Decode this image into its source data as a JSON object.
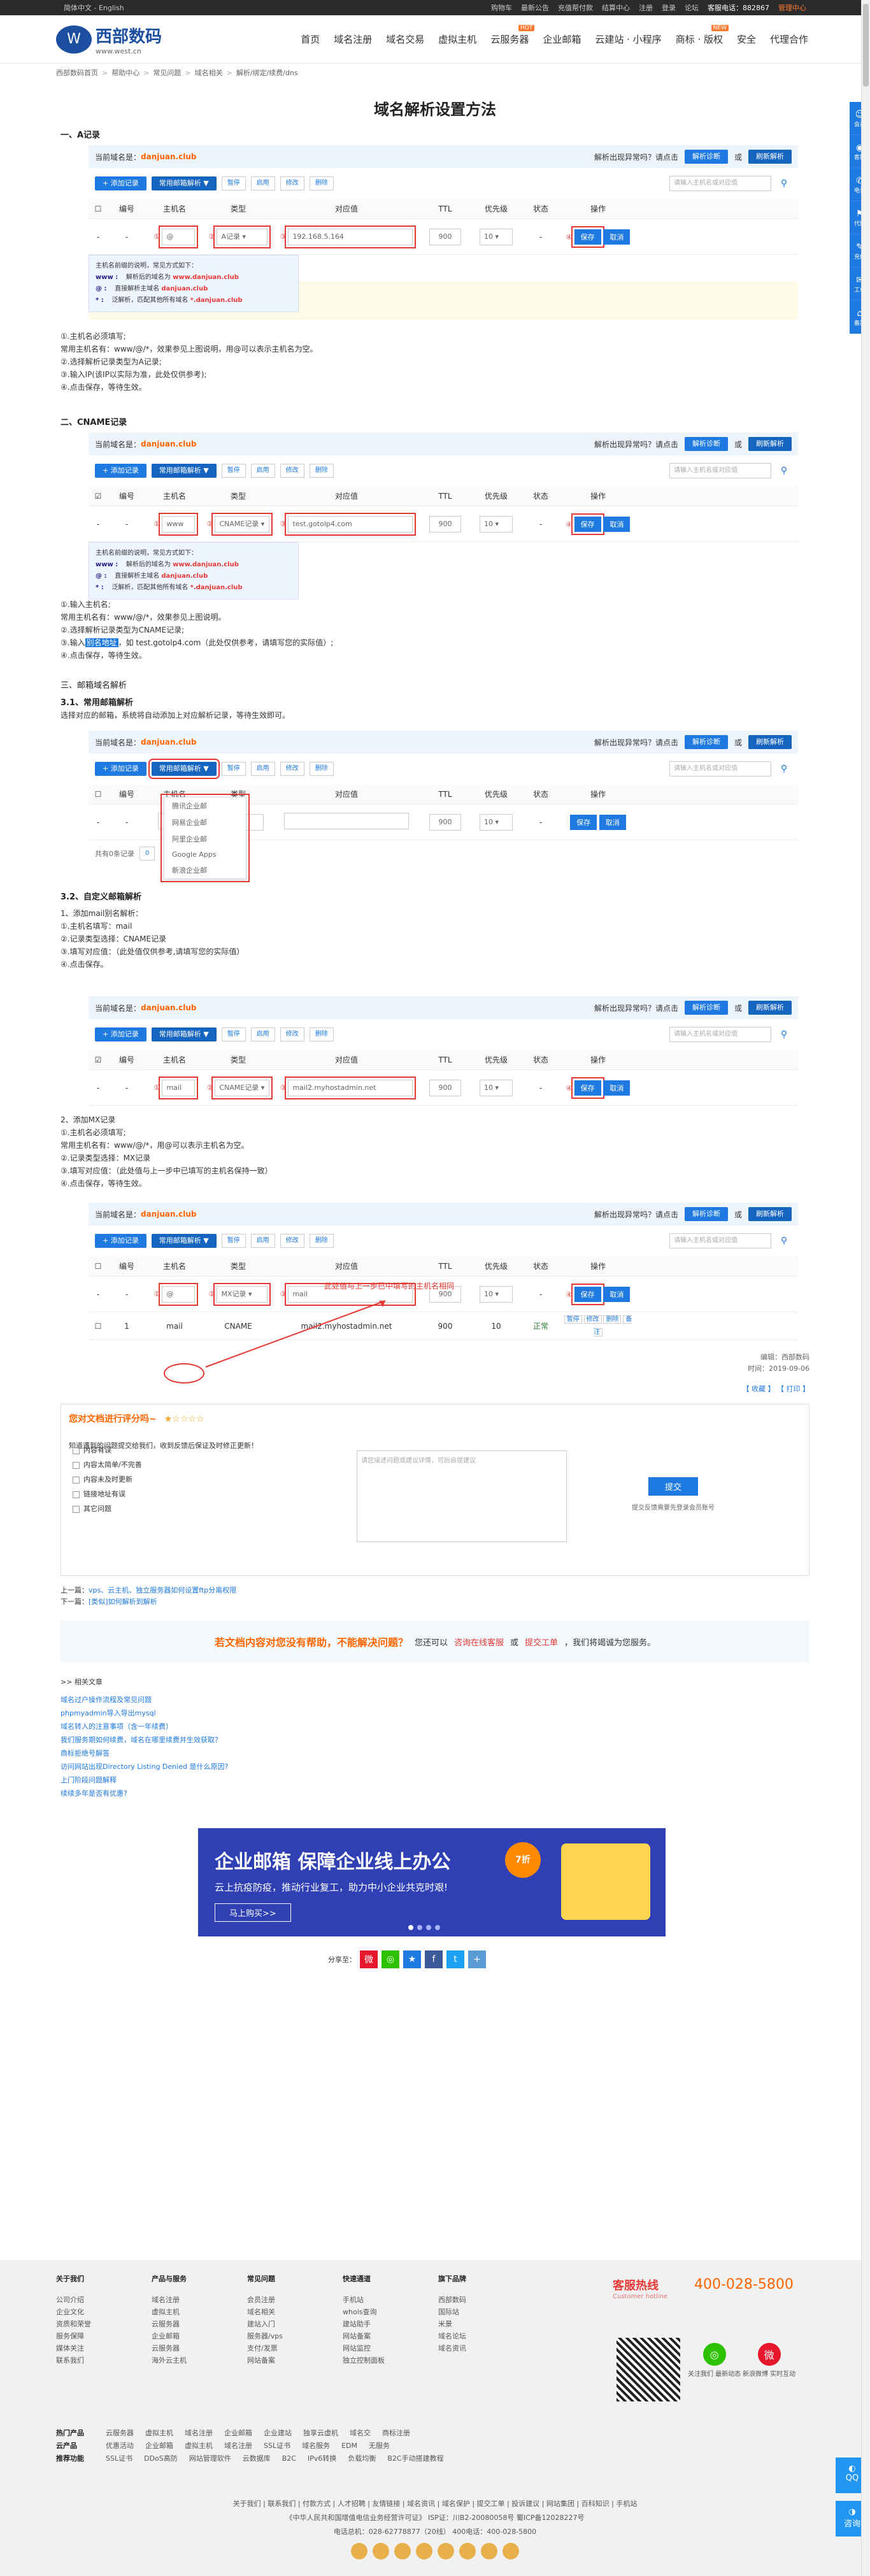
{
  "topbar": {
    "lang": "简体中文 - English",
    "cart": "购物车",
    "notice": "最新公告",
    "recharge": "充值帮付款",
    "settle": "结算中心",
    "reg": "注册",
    "login": "登录",
    "forum": "论坛",
    "phone": "客服电话：882867",
    "user": "管理中心"
  },
  "logo": {
    "name": "西部数码",
    "url": "www.west.cn"
  },
  "nav": [
    {
      "label": "首页"
    },
    {
      "label": "域名注册"
    },
    {
      "label": "域名交易"
    },
    {
      "label": "虚拟主机"
    },
    {
      "label": "云服务器",
      "badge": "HOT"
    },
    {
      "label": "企业邮箱"
    },
    {
      "label": "云建站 · 小程序"
    },
    {
      "label": "商标 · 版权",
      "badge": "NEW"
    },
    {
      "label": "安全"
    },
    {
      "label": "代理合作"
    }
  ],
  "breadcrumb": [
    "西部数码首页",
    "帮助中心",
    "常见问题",
    "域名相关",
    "解析/绑定/续费/dns"
  ],
  "title": "域名解析设置方法",
  "sections": {
    "a": {
      "heading": "一、A记录"
    },
    "cname": {
      "heading": "二、CNAME记录"
    },
    "mail": {
      "heading": "三、邮箱域名解析",
      "sub": "3.1、常用邮箱解析",
      "desc": "选择对应的邮箱，系统将自动添加上对应解析记录，等待生效即可。"
    },
    "custom": {
      "sub": "3.2、自定义邮箱解析"
    }
  },
  "panel": {
    "domain_label": "当前域名是：",
    "domain": "danjuan.club",
    "question": "解析出现异常吗？请点击",
    "btn_diag": "解析诊断",
    "or": "或",
    "btn_refresh": "刷新解析",
    "btn_add": "+ 添加记录",
    "btn_common": "常用邮箱解析 ▼",
    "btn_pause": "暂停",
    "btn_enable": "启用",
    "btn_edit": "修改",
    "btn_delete": "删除",
    "search_placeholder": "请输入主机名或对应值",
    "cols": [
      "",
      "编号",
      "主机名",
      "类型",
      "对应值",
      "TTL",
      "优先级",
      "状态",
      "操作"
    ],
    "save": "保存",
    "cancel": "取消",
    "ttl": "900",
    "prio": "10"
  },
  "a_row": {
    "host": "@",
    "type": "A记录",
    "value": "192.168.5.164"
  },
  "cname_row": {
    "host": "www",
    "type": "CNAME记录",
    "value": "test.gotolp4.com"
  },
  "mail_row": {
    "type": "A记录"
  },
  "custom_row": {
    "host": "mail",
    "type": "CNAME记录",
    "value": "mail2.myhostadmin.net"
  },
  "mx_row": {
    "host": "@",
    "type": "MX记录",
    "value": "mail"
  },
  "mx_saved": {
    "num": "1",
    "host": "mail",
    "type": "CNAME",
    "value": "mail2.myhostadmin.net",
    "ttl": "900",
    "prio": "10",
    "status": "正常",
    "ops": [
      "暂停",
      "修改",
      "删除",
      "备注"
    ]
  },
  "tip": {
    "title": "主机名前缀的说明，常见方式如下：",
    "rows": [
      {
        "k": "www :",
        "v1": "解析后的域名为 ",
        "v2": "www.danjuan.club"
      },
      {
        "k": "@ :",
        "v1": "直接解析主域名 ",
        "v2": "danjuan.club"
      },
      {
        "k": "* :",
        "v1": "泛解析，匹配其他所有域名 ",
        "v2": "*.danjuan.club"
      }
    ]
  },
  "a_text": [
    "①.主机名必须填写;",
    "常用主机名有：www/@/*，效果参见上图说明，用@可以表示主机名为空。",
    "②.选择解析记录类型为A记录;",
    "③.输入IP(该IP以实际为准，此处仅供参考);",
    "④.点击保存，等待生效。"
  ],
  "cname_text": [
    "①.输入主机名;",
    "常用主机名有：www/@/*，效果参见上图说明。",
    "②.选择解析记录类型为CNAME记录;",
    "③.输入",
    "别名地址",
    "，如 test.gotolp4.com（此处仅供参考，请填写您的实际值）;",
    "④.点击保存，等待生效。"
  ],
  "mail_dropdown": [
    "腾讯企业邮",
    "网易企业邮",
    "阿里企业邮",
    "Google Apps",
    "新浪企业邮"
  ],
  "pager": {
    "total": "共有0条记录",
    "page": "0"
  },
  "custom_text": [
    "1、添加mail别名解析：",
    "①.主机名填写：mail",
    "②.记录类型选择：CNAME记录",
    "③.填写对应值：（此处值仅供参考,请填写您的实际值）",
    "④.点击保存。"
  ],
  "mx_text": [
    "2、添加MX记录",
    "①.主机名必须填写;",
    "常用主机名有：www/@/*，用@可以表示主机名为空。",
    "②.记录类型选择：MX记录",
    "③.填写对应值：（此处值与上一步中已填写的主机名保持一致）",
    "④.点击保存，等待生效。"
  ],
  "mx_annotation": "此处值与上一步已中填写的主机名相同",
  "meta": {
    "editor": "编辑：西部数码",
    "date": "时间：2019-09-06",
    "collect": "【 收藏 】",
    "print": "【 打印 】"
  },
  "feedback": {
    "title": "您对文档进行评分吗~",
    "stars": "★☆☆☆☆",
    "intro": "知道遇到的问题提交给我们，收到反馈后保证及时修正更新！",
    "options": [
      "内容有误",
      "内容太简单/不完善",
      "内容未及时更新",
      "链接地址有误",
      "其它问题"
    ],
    "placeholder": "请您描述问题或建议详情，可后自提建议",
    "submit": "提交",
    "note": "提交反馈需要先登录会员账号"
  },
  "prevnext": {
    "prev_label": "上一篇：",
    "prev": "vps、云主机、独立服务器如何设置ftp分离权限",
    "next_label": "下一篇：",
    "next": "[类似]如何解析到解析"
  },
  "help": {
    "q": "若文档内容对您没有帮助，不能解决问题？",
    "mid": "您还可以",
    "link1": "咨询在线客服",
    "or": "或",
    "link2": "提交工单",
    "tail": "，我们将竭诚为您服务。"
  },
  "related": {
    "title": ">> 相关文章",
    "items": [
      "域名过户操作流程及常见问题",
      "phpmyadmin导入导出mysql",
      "域名转入的注意事项（含一年续费）",
      "我们服务期如何续费，域名在哪里续费并生效获取？",
      "商标拒绝号解答",
      "访问网站出现Directory Listing Denied 是什么原因?",
      "上门阶段问题解释",
      "续续多年是否有优惠?"
    ]
  },
  "banner": {
    "line1": "企业邮箱 保障企业线上办公",
    "line2": "云上抗疫防疫，推动行业复工，助力中小企业共克时艰!",
    "btn": "马上购买>>",
    "tag": "7折"
  },
  "share": {
    "label": "分享至："
  },
  "footer": {
    "cols": [
      {
        "h": "关于我们",
        "items": [
          "公司介绍",
          "企业文化",
          "资质和荣誉",
          "服务保障",
          "媒体关注",
          "联系我们"
        ]
      },
      {
        "h": "产品与服务",
        "items": [
          "域名注册",
          "虚拟主机",
          "云服务器",
          "企业邮箱",
          "云服务器",
          "海外云主机"
        ]
      },
      {
        "h": "常见问题",
        "items": [
          "会员注册",
          "域名相关",
          "建站入门",
          "服务器/vps",
          "支付/发票",
          "网站备案"
        ]
      },
      {
        "h": "快速通道",
        "items": [
          "手机站",
          "whois查询",
          "建站助手",
          "网站备案",
          "网站监控",
          "独立控制面板"
        ]
      },
      {
        "h": "旗下品牌",
        "items": [
          "西部数码",
          "国际站",
          "米景",
          "域名论坛",
          "域名资讯"
        ]
      }
    ],
    "hotline_label": "客服热线",
    "hotline_en": "Customer hotline",
    "hotline": "400-028-5800",
    "social": [
      {
        "label": "关注我们 最新动态"
      },
      {
        "label": "新浪微博 实时互动"
      }
    ],
    "links": [
      {
        "lab": "热门产品",
        "items": [
          "云服务器",
          "虚拟主机",
          "域名注册",
          "企业邮箱",
          "企业建站",
          "独享云虚机",
          "域名交",
          "商标注册"
        ]
      },
      {
        "lab": "云产品",
        "items": [
          "优惠活动",
          "企业邮箱",
          "虚拟主机",
          "域名注册",
          "SSL证书",
          "域名服务",
          "EDM",
          "无服务"
        ]
      },
      {
        "lab": "推荐功能",
        "items": [
          "SSL证书",
          "DDoS高防",
          "网站管理软件",
          "云数据库",
          "B2C",
          "IPv6转换",
          "负载均衡",
          "B2C手动搭建教程"
        ]
      }
    ],
    "bottom1": "关于我们 | 联系我们 | 付款方式 | 人才招聘 | 友情链接 | 域名资讯 | 域名保护 | 提交工单 | 投诉建议 | 网站集团 | 百科知识 | 手机站",
    "bottom2": "《中华人民共和国增值电信业务经营许可证》 ISP证：川B2-20080058号 蜀ICP备12028227号",
    "bottom3": "电话总机：028-62778877（20线）     400电话：400-028-5800"
  },
  "sidebar": [
    {
      "icon": "☺",
      "label": "会员"
    },
    {
      "icon": "◉",
      "label": "客服"
    },
    {
      "icon": "✆",
      "label": "电话"
    },
    {
      "icon": "⚑",
      "label": "代理"
    },
    {
      "icon": "✎",
      "label": "充值"
    },
    {
      "icon": "✉",
      "label": "工单"
    },
    {
      "icon": "⌂",
      "label": "备案"
    }
  ],
  "float": {
    "qq": "QQ",
    "chat": "咨询"
  },
  "colors": {
    "accent": "#1e7ae0",
    "orange": "#ff6600",
    "red": "#e53935",
    "dark_nav": "#2b2b2b"
  }
}
